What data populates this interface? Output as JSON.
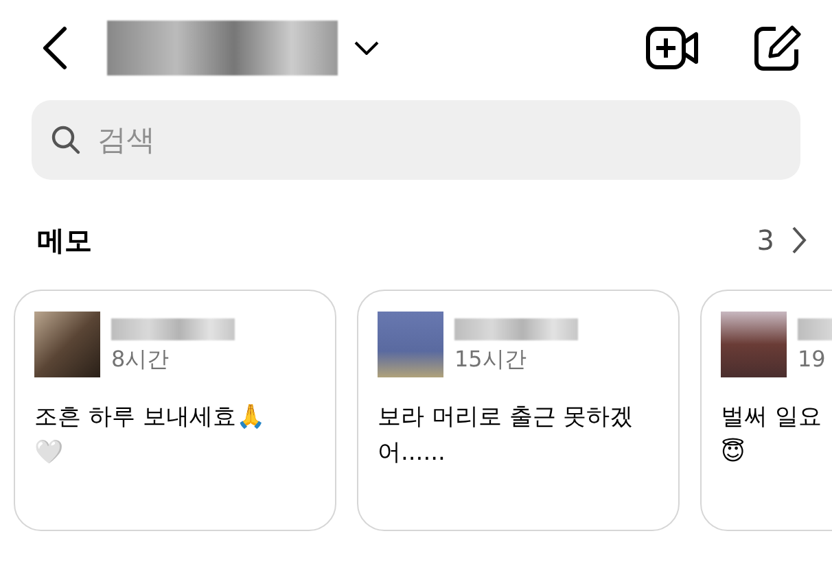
{
  "header": {
    "has_dropdown": true
  },
  "search": {
    "placeholder": "검색"
  },
  "notes_section": {
    "title": "메모",
    "count": "3"
  },
  "notes": [
    {
      "time": "8시간",
      "lines": [
        "조흔 하루 보내세효🙏",
        "🤍"
      ]
    },
    {
      "time": "15시간",
      "lines": [
        "보라 머리로 출근 못하겠",
        "어......"
      ]
    },
    {
      "time": "19",
      "lines": [
        "벌써 일요",
        "😇"
      ]
    }
  ]
}
